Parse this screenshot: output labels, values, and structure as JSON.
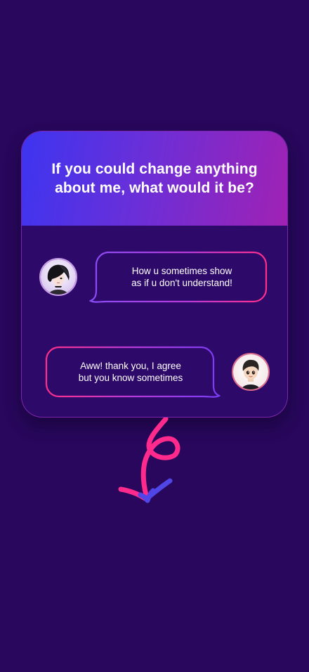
{
  "card": {
    "title": "If you could change anything about me, what would it be?"
  },
  "messages": [
    {
      "sender": "left-avatar",
      "text_line1": "How u sometimes show",
      "text_line2": "as if u don't understand!"
    },
    {
      "sender": "right-avatar",
      "text_line1": "Aww! thank you, I agree",
      "text_line2": "but you know sometimes"
    }
  ],
  "colors": {
    "background": "#28075c",
    "card_body": "#2d0a6a",
    "header_start": "#3d35f0",
    "header_end": "#a022b4",
    "bubble_pink": "#ff2e8a",
    "bubble_violet": "#7a3cf5",
    "arrow_pink": "#ff2a8c",
    "arrow_blue": "#5046e8"
  },
  "icons": {
    "left_avatar": "emo-girl-avatar",
    "right_avatar": "boy-avatar",
    "arrow": "curly-down-arrow-icon"
  }
}
